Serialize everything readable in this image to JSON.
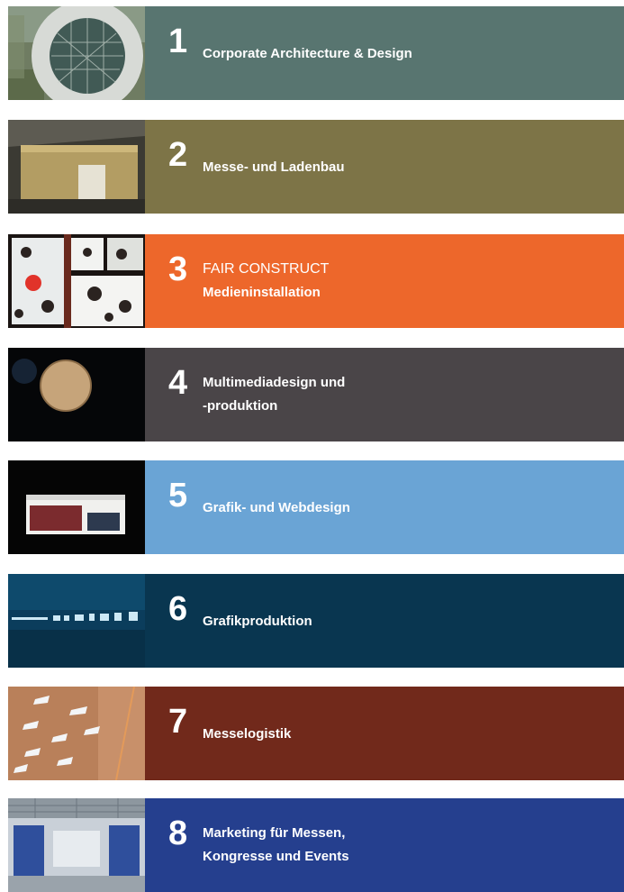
{
  "items": [
    {
      "num": "1",
      "lines": [
        "Corporate Architecture & Design"
      ],
      "color": "#587570",
      "thumb": "sphere-structure-photo"
    },
    {
      "num": "2",
      "lines": [
        "Messe- und Ladenbau"
      ],
      "color": "#7d7447",
      "thumb": "exhibition-hall-photo"
    },
    {
      "num": "3",
      "lines": [
        "FAIR CONSTRUCT",
        "Medieninstallation"
      ],
      "color": "#ed672b",
      "thumb": "media-installation-photo"
    },
    {
      "num": "4",
      "lines": [
        "Multimediadesign und",
        "-produktion"
      ],
      "color": "#4a4548",
      "thumb": "glowing-orb-photo"
    },
    {
      "num": "5",
      "lines": [
        "Grafik- und Webdesign"
      ],
      "color": "#6aa4d5",
      "thumb": "web-design-screen-photo"
    },
    {
      "num": "6",
      "lines": [
        "Grafikproduktion"
      ],
      "color": "#093650",
      "thumb": "lights-row-photo"
    },
    {
      "num": "7",
      "lines": [
        "Messelogistik"
      ],
      "color": "#71291b",
      "thumb": "ceiling-lights-photo"
    },
    {
      "num": "8",
      "lines": [
        "Marketing für Messen,",
        "Kongresse und Events"
      ],
      "color": "#253f8e",
      "thumb": "trade-fair-booth-photo"
    }
  ]
}
